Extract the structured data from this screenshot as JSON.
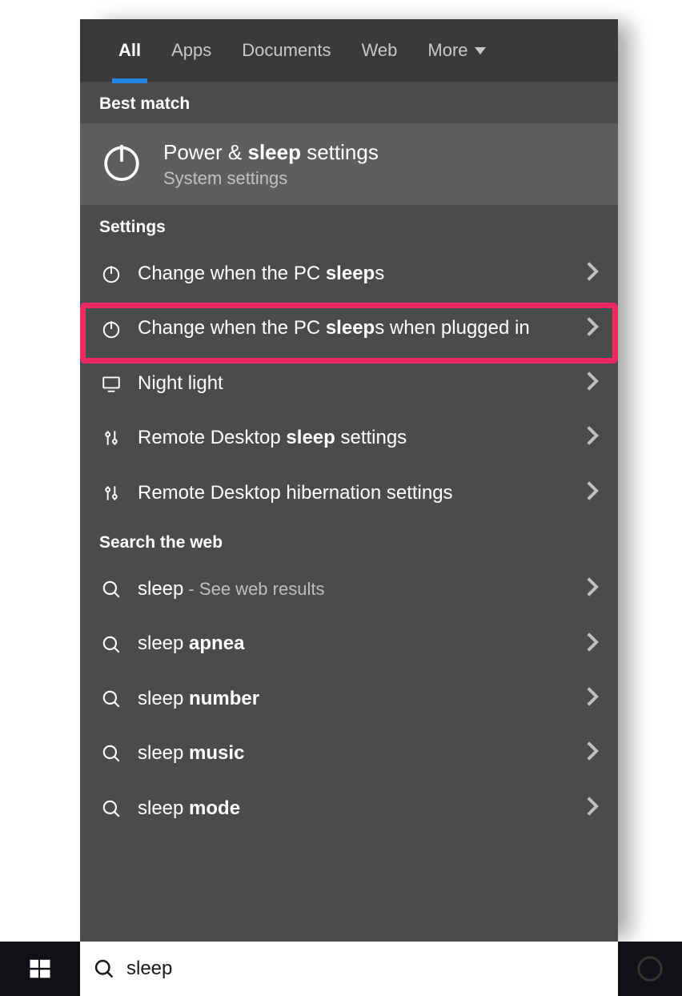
{
  "tabs": {
    "all": "All",
    "apps": "Apps",
    "documents": "Documents",
    "web": "Web",
    "more": "More"
  },
  "headings": {
    "best": "Best match",
    "settings": "Settings",
    "web": "Search the web"
  },
  "best": {
    "title_prefix": "Power & ",
    "title_bold": "sleep",
    "title_suffix": " settings",
    "sub": "System settings"
  },
  "settings": [
    {
      "icon": "power",
      "pre": "Change when the PC ",
      "bold": "sleep",
      "post": "s"
    },
    {
      "icon": "power",
      "pre": "Change when the PC ",
      "bold": "sleep",
      "post": "s when plugged in"
    },
    {
      "icon": "monitor",
      "pre": "Night light",
      "bold": "",
      "post": ""
    },
    {
      "icon": "sliders",
      "pre": "Remote Desktop ",
      "bold": "sleep",
      "post": " settings"
    },
    {
      "icon": "sliders",
      "pre": "Remote Desktop hibernation settings",
      "bold": "",
      "post": ""
    }
  ],
  "web_results": [
    {
      "term": "sleep",
      "rest": "",
      "sub": " - See web results"
    },
    {
      "term": "sleep ",
      "rest": "apnea",
      "sub": ""
    },
    {
      "term": "sleep ",
      "rest": "number",
      "sub": ""
    },
    {
      "term": "sleep ",
      "rest": "music",
      "sub": ""
    },
    {
      "term": "sleep ",
      "rest": "mode",
      "sub": ""
    }
  ],
  "search": {
    "value": "sleep"
  },
  "highlight_color": "#ee2a62"
}
